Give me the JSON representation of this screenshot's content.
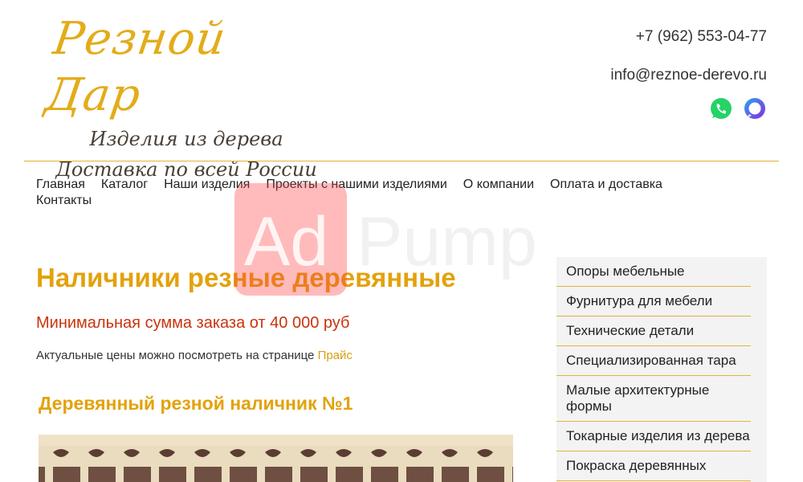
{
  "header": {
    "logo_title": "Резной Дар",
    "logo_line1": "Изделия из дерева",
    "logo_line2": "Доставка по всей России",
    "phone": "+7 (962) 553-04-77",
    "email": "info@reznoe-derevo.ru",
    "socials": [
      {
        "name": "whatsapp-icon",
        "color": "#25d366"
      },
      {
        "name": "messenger-icon",
        "color": "#5b3fe0"
      }
    ]
  },
  "nav": {
    "items": [
      "Главная",
      "Каталог",
      "Наши изделия",
      "Проекты с нашими изделиями",
      "О компании",
      "Оплата и доставка",
      "Контакты"
    ]
  },
  "main": {
    "title": "Наличники резные деревянные",
    "min_order": "Минимальная сумма заказа от 40 000 руб",
    "prices_text": "Актуальные цены можно посмотреть на странице",
    "prices_link": "Прайс",
    "section_title": "Деревянный резной наличник №1"
  },
  "sidebar": {
    "items": [
      "Опоры мебельные",
      "Фурнитура для мебели",
      "Технические детали",
      "Специализированная тара",
      "Малые архитектурные формы",
      "Токарные изделия из дерева",
      "Покраска деревянных"
    ]
  },
  "watermark": {
    "ad": "Ad",
    "pump": "Pump"
  },
  "colors": {
    "accent": "#e3a20c",
    "red": "#c9340c",
    "divider": "#e3b23c"
  }
}
